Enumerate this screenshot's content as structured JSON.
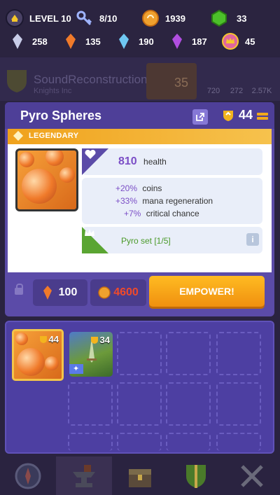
{
  "resources_row1": [
    {
      "icon": "level-badge-icon",
      "label": "LEVEL 10"
    },
    {
      "icon": "key-icon",
      "label": "8/10"
    },
    {
      "icon": "coin-icon",
      "label": "1939"
    },
    {
      "icon": "green-gem-icon",
      "label": "33"
    }
  ],
  "resources_row2": [
    {
      "icon": "silver-crystal-icon",
      "label": "258"
    },
    {
      "icon": "orange-crystal-icon",
      "label": "135"
    },
    {
      "icon": "blue-crystal-icon",
      "label": "190"
    },
    {
      "icon": "purple-crystal-icon",
      "label": "187"
    },
    {
      "icon": "crown-token-icon",
      "label": "45"
    }
  ],
  "background_panel": {
    "name": "SoundReconstruction1",
    "subtitle": "Knights Inc",
    "level": "35",
    "stats": [
      "720",
      "272",
      "2.57K"
    ]
  },
  "item": {
    "title": "Pyro Spheres",
    "level": "44",
    "rarity": "LEGENDARY",
    "health_value": "810",
    "health_label": "health",
    "bonuses": [
      {
        "pct": "+20%",
        "label": "coins"
      },
      {
        "pct": "+33%",
        "label": "mana regeneration"
      },
      {
        "pct": "+7%",
        "label": "critical chance"
      }
    ],
    "set_label": "Pyro set [1/5]",
    "info_label": "i",
    "cost_crystals": "100",
    "cost_coins": "4600",
    "empower_label": "EMPOWER!"
  },
  "inventory": [
    {
      "name": "pyro-spheres",
      "level": "44"
    },
    {
      "name": "forest-sword",
      "level": "34"
    }
  ],
  "colors": {
    "accent_orange": "#f0900f",
    "panel_purple": "#5b4ba8",
    "legendary_gold": "#f0a21c",
    "set_green": "#5aa532"
  }
}
